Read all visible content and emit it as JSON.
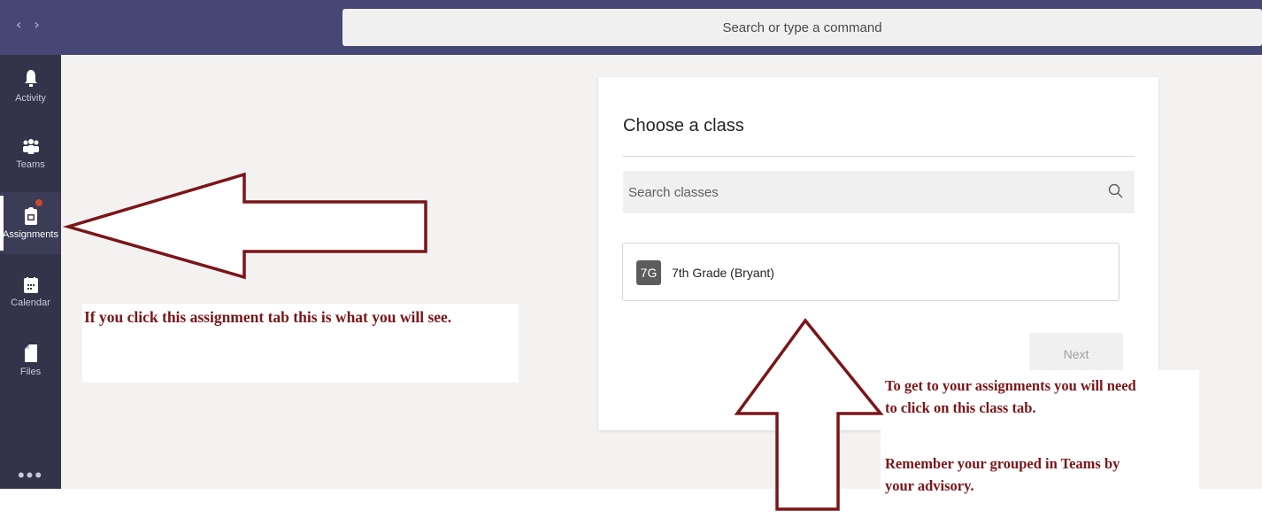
{
  "search": {
    "placeholder": "Search or type a command"
  },
  "nav": {
    "back": "‹",
    "forward": "›"
  },
  "rail": {
    "items": [
      {
        "label": "Activity",
        "icon": "bell-icon"
      },
      {
        "label": "Teams",
        "icon": "teams-icon"
      },
      {
        "label": "Assignments",
        "icon": "assignments-icon",
        "active": true,
        "badge": "dot"
      },
      {
        "label": "Calendar",
        "icon": "calendar-icon"
      },
      {
        "label": "Files",
        "icon": "file-icon"
      }
    ],
    "more": "•••"
  },
  "card": {
    "title": "Choose a class",
    "search_placeholder": "Search classes",
    "class_item": {
      "avatar": "7G",
      "name": "7th Grade (Bryant)"
    },
    "next_label": "Next"
  },
  "annotations": {
    "left_note": "If you click this assignment tab this is what you will see.",
    "right_note": {
      "line1": "To get to your assignments you will need",
      "line2": "to click on this class tab.",
      "line3": "Remember your grouped in Teams by",
      "line4": "your advisory."
    }
  },
  "colors": {
    "topbar": "#464775",
    "rail": "#33344a",
    "content_bg": "#f3f2f1",
    "annotation": "#7b1518",
    "badge": "#cc4a31"
  }
}
